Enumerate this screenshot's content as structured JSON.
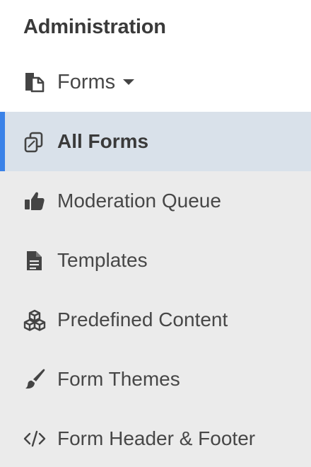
{
  "section": {
    "title": "Administration"
  },
  "forms_menu": {
    "label": "Forms",
    "icon": "forms-icon",
    "expanded": true
  },
  "items": [
    {
      "label": "All Forms",
      "icon": "copy-icon",
      "active": true
    },
    {
      "label": "Moderation Queue",
      "icon": "thumbs-up-icon",
      "active": false
    },
    {
      "label": "Templates",
      "icon": "document-icon",
      "active": false
    },
    {
      "label": "Predefined Content",
      "icon": "cubes-icon",
      "active": false
    },
    {
      "label": "Form Themes",
      "icon": "paintbrush-icon",
      "active": false
    },
    {
      "label": "Form Header & Footer",
      "icon": "code-icon",
      "active": false
    }
  ],
  "colors": {
    "active_bar": "#3b82e8",
    "active_bg": "#d9e1ea",
    "submenu_bg": "#ebebeb",
    "text": "#474747"
  }
}
